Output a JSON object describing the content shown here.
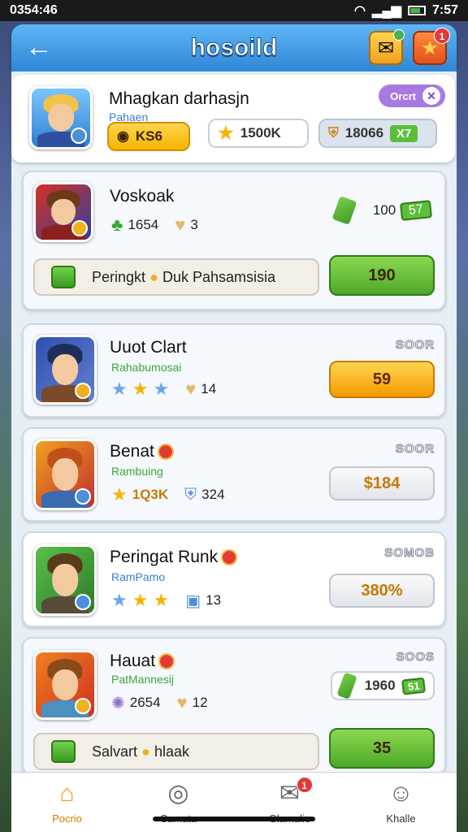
{
  "status": {
    "time_left": "0354:46",
    "time_right": "7:57"
  },
  "header": {
    "title": "hosoild",
    "mail_badge": "",
    "star_badge": "1"
  },
  "profile": {
    "name": "Mhagkan darhasjn",
    "subtitle": "Pahaen",
    "gold": "KS6",
    "stars": "1500K",
    "gems": "18066",
    "level": "X7",
    "chip": "Orcrt"
  },
  "cards": [
    {
      "name": "Voskoak",
      "stat1": "1654",
      "stat2": "3",
      "cash": "100",
      "cash_tag": "57",
      "bar_text": "Peringkt",
      "bar_text2": "Duk Pahsamsisia",
      "button": "190"
    },
    {
      "name": "Uuot Clart",
      "subtitle": "Rahabumosai",
      "code": "SOOR",
      "stat2": "14",
      "button": "59"
    },
    {
      "name": "Benat",
      "subtitle": "Rambuing",
      "code": "SOOR",
      "stat1": "1Q3K",
      "stat2": "324",
      "button": "$184"
    },
    {
      "name": "Peringat Runk",
      "subtitle": "RamPamo",
      "code": "SOMOB",
      "stat2": "13",
      "button": "380%"
    },
    {
      "name": "Hauat",
      "subtitle": "PatMannesij",
      "code": "SOOS",
      "stat1": "2654",
      "stat2": "12",
      "cash": "1960",
      "cash_tag": "51",
      "bar_text": "Salvart",
      "bar_text2": "hlaak",
      "button": "35"
    }
  ],
  "tabs": [
    {
      "label": "Pocrio",
      "icon": "home-icon",
      "active": true
    },
    {
      "label": "Camata",
      "icon": "compass-icon",
      "active": false
    },
    {
      "label": "Glamalie",
      "icon": "mail-icon",
      "active": false,
      "badge": "1"
    },
    {
      "label": "Khalle",
      "icon": "user-icon",
      "active": false
    }
  ],
  "colors": {
    "accent": "#2f86d6",
    "primary_button": "#5bbf3a",
    "highlight": "#f5b400"
  }
}
